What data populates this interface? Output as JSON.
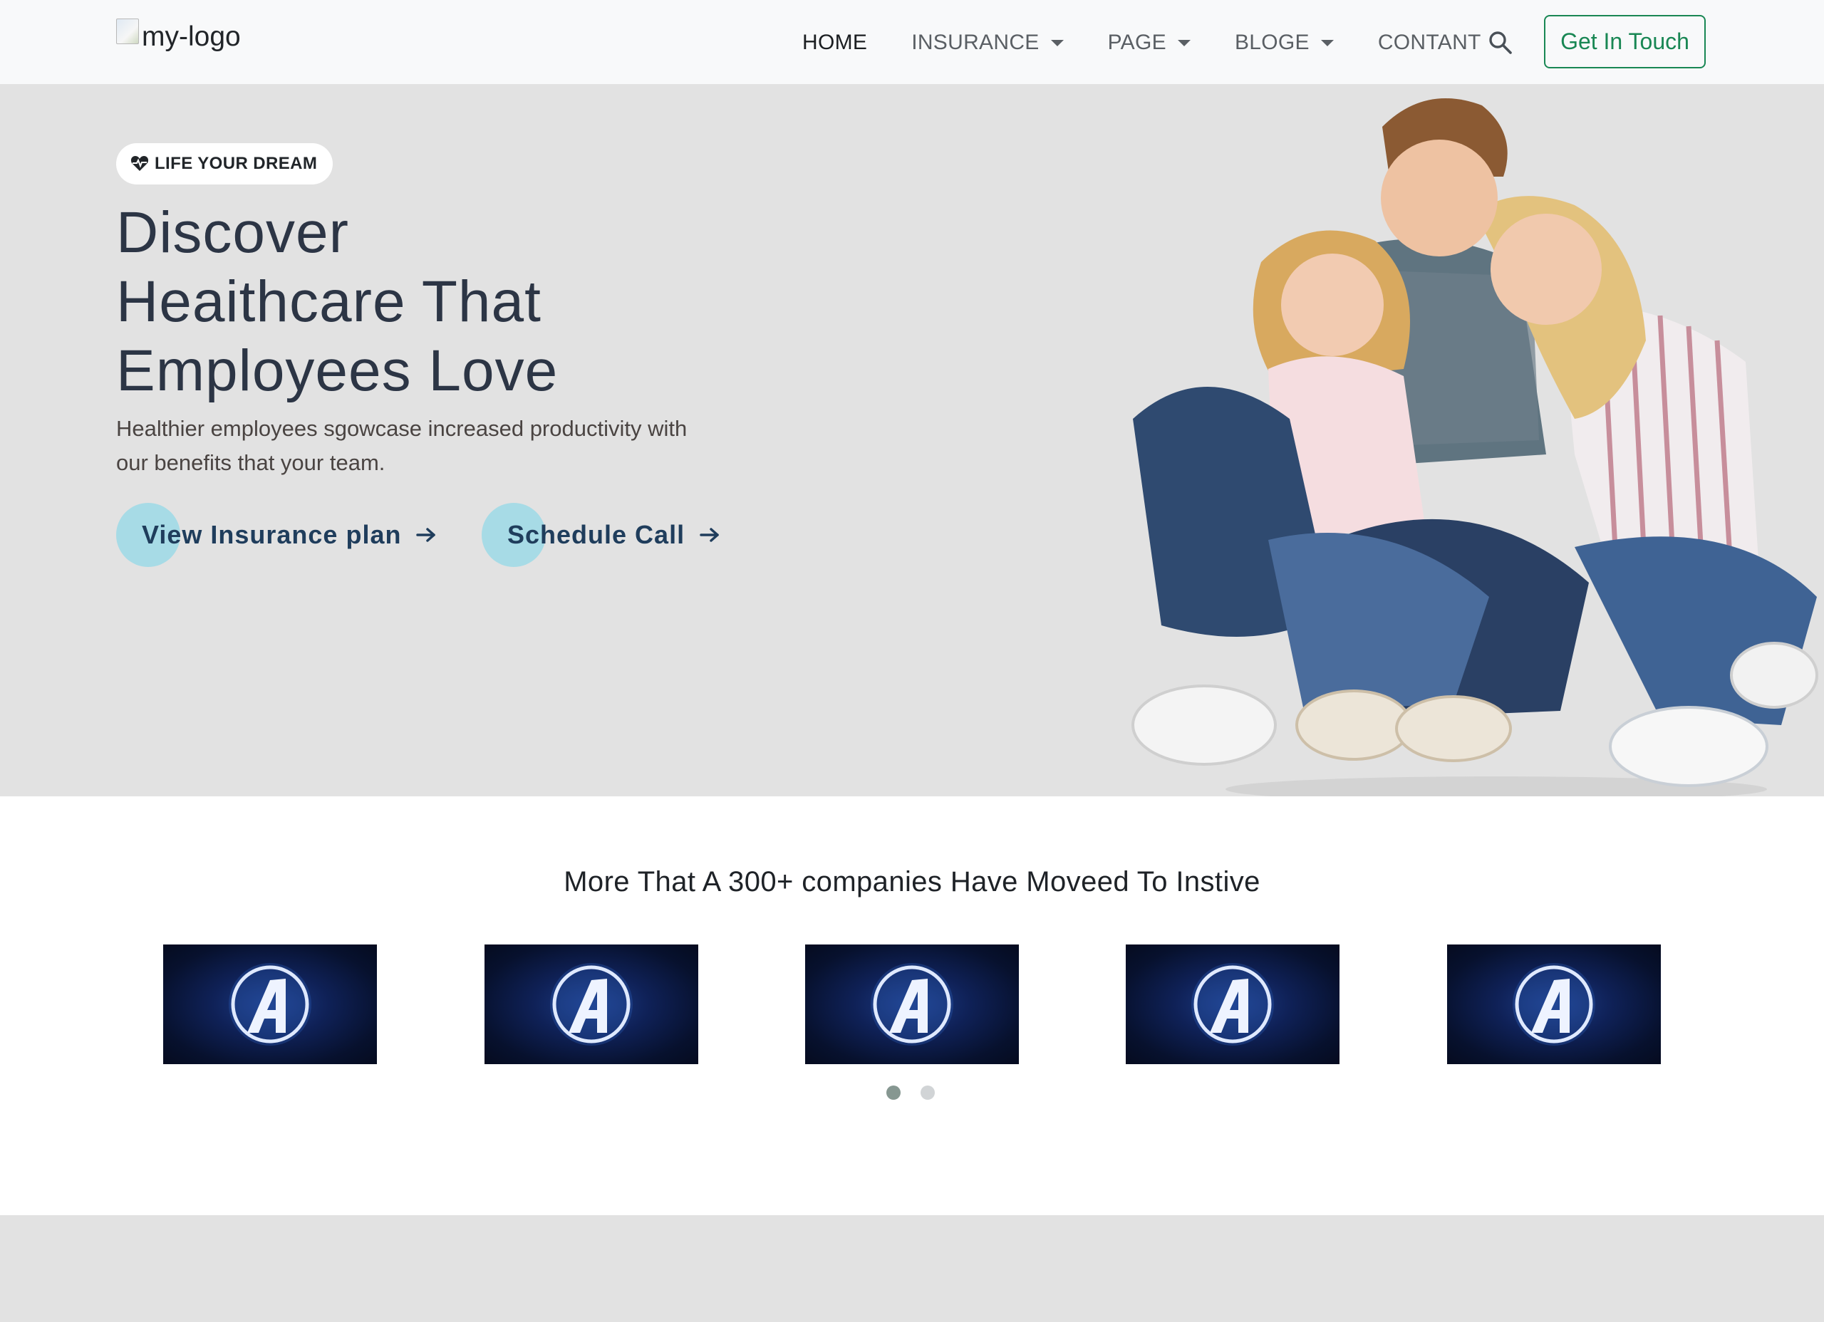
{
  "header": {
    "logo_alt": "my-logo",
    "nav": [
      {
        "label": "HOME",
        "active": true,
        "dropdown": false
      },
      {
        "label": "INSURANCE",
        "active": false,
        "dropdown": true
      },
      {
        "label": "PAGE",
        "active": false,
        "dropdown": true
      },
      {
        "label": "BLOGE",
        "active": false,
        "dropdown": true
      },
      {
        "label": "CONTANT",
        "active": false,
        "dropdown": false
      }
    ],
    "search_icon": "search-icon",
    "cta_label": "Get In Touch"
  },
  "hero": {
    "badge_icon": "heart-pulse-icon",
    "badge": "LIFE YOUR DREAM",
    "title_lines": [
      "Discover",
      "Heaithcare That",
      "Employees Love"
    ],
    "subtitle_lines": [
      "Healthier employees sgowcase increased productivity with",
      "our benefits that your team."
    ],
    "buttons": [
      {
        "label": "View Insurance plan",
        "icon": "arrow-right-icon"
      },
      {
        "label": "Schedule Call",
        "icon": "arrow-right-icon"
      }
    ],
    "image": "family-photo"
  },
  "partners": {
    "title": "More That A 300+ companies Have Moveed To Instive",
    "logos": [
      "avengers-logo",
      "avengers-logo",
      "avengers-logo",
      "avengers-logo",
      "avengers-logo"
    ],
    "carousel_pages": 2,
    "active_page": 1
  },
  "colors": {
    "navbar_bg": "#f8f9fa",
    "hero_bg": "#e2e2e2",
    "cta_green": "#198754",
    "hero_title": "#2c3545",
    "button_text": "#1f3d5c",
    "button_circle": "#a7dbe6"
  }
}
